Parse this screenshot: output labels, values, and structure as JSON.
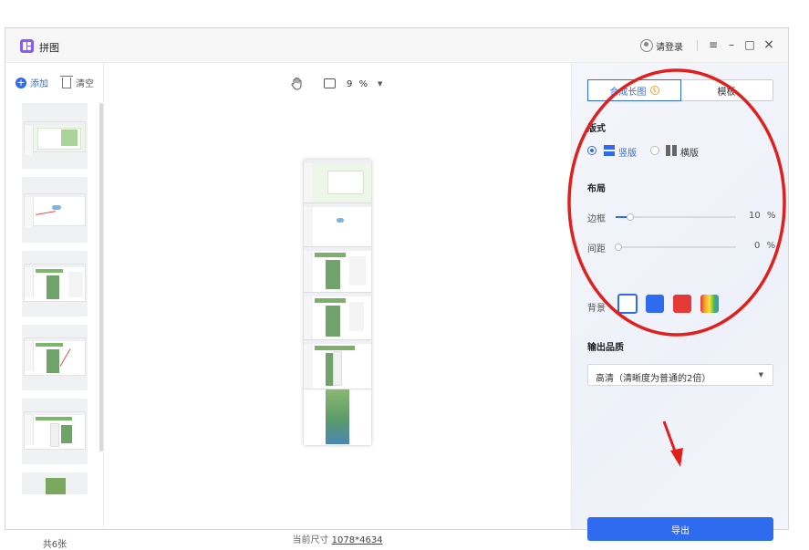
{
  "app": {
    "title": "拼图",
    "login": "请登录"
  },
  "window_controls": {
    "menu": "≡",
    "minimize": "–",
    "maximize": "□",
    "close": "×"
  },
  "left_panel": {
    "add_label": "添加",
    "clear_label": "清空",
    "count_label": "共6张"
  },
  "canvas_toolbar": {
    "zoom_value": "9",
    "zoom_unit": "%"
  },
  "canvas_footer": {
    "size_label": "当前尺寸",
    "size_value": "1078*4634"
  },
  "right_panel": {
    "tabs": [
      {
        "label": "合成长图",
        "active": true,
        "badge": "$"
      },
      {
        "label": "模板",
        "active": false
      }
    ],
    "style_section": {
      "title": "版式",
      "options": [
        {
          "label": "竖版",
          "selected": true
        },
        {
          "label": "横版",
          "selected": false
        }
      ]
    },
    "layout_section": {
      "title": "布局",
      "border": {
        "label": "边框",
        "value": "10",
        "unit": "%"
      },
      "spacing": {
        "label": "间距",
        "value": "0",
        "unit": "%"
      },
      "background": {
        "label": "背景"
      }
    },
    "quality_section": {
      "title": "输出品质",
      "selected": "高清（清晰度为普通的2倍）"
    },
    "export_label": "导出"
  },
  "colors": {
    "accent": "#2f6bef",
    "swatch_white": "#ffffff",
    "swatch_blue": "#2f6bef",
    "swatch_red": "#e53935",
    "annotation_red": "#e0201c"
  }
}
